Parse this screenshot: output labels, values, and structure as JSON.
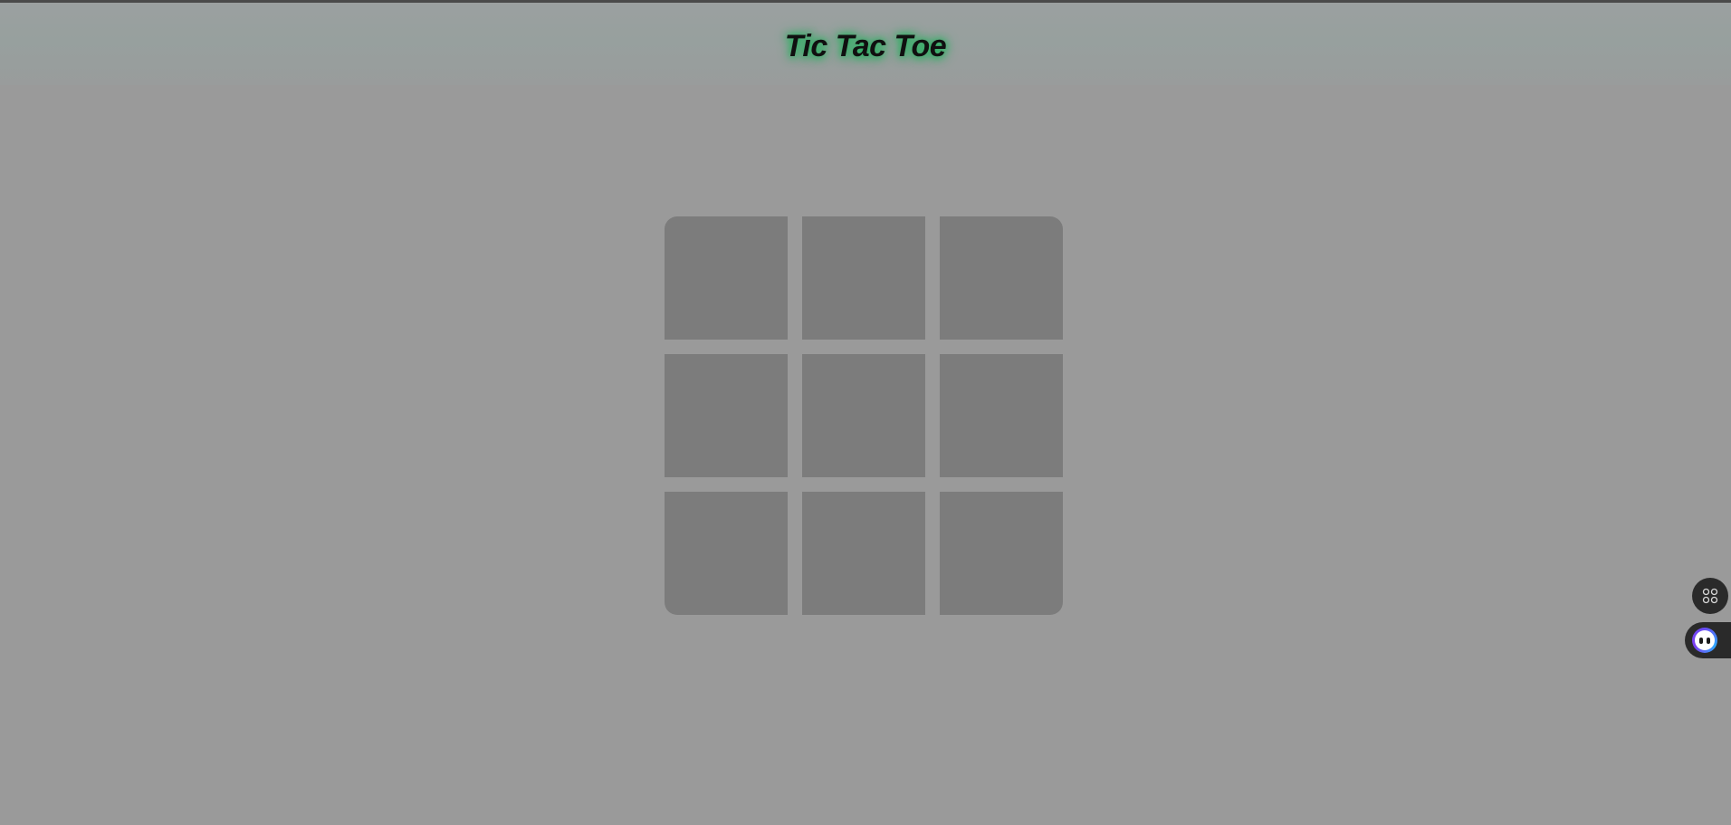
{
  "header": {
    "title": "Tic Tac Toe"
  },
  "board": {
    "cells": [
      "",
      "",
      "",
      "",
      "",
      "",
      "",
      "",
      ""
    ]
  },
  "floating": {
    "apps_icon": "grid-apps-icon",
    "assistant_icon": "assistant-face-icon"
  },
  "colors": {
    "background": "#9a9a9a",
    "cell": "#7c7c7c",
    "title_glow": "#2fb063"
  }
}
